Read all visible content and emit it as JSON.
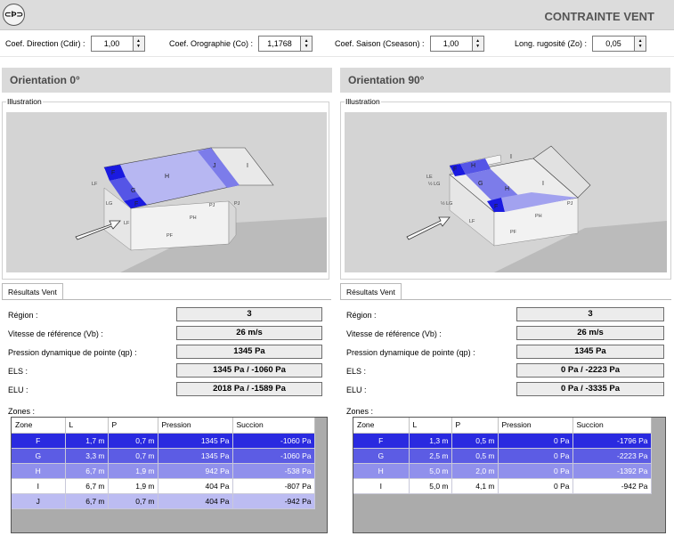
{
  "header": {
    "logo_text": "⊂Þ⊃",
    "title": "CONTRAINTE VENT"
  },
  "coefs": [
    {
      "label": "Coef. Direction (Cdir) :",
      "value": "1,00"
    },
    {
      "label": "Coef. Orographie (Co) :",
      "value": "1,1768"
    },
    {
      "label": "Coef. Saison (Cseason) :",
      "value": "1,00"
    },
    {
      "label": "Long. rugosité (Zo) :",
      "value": "0,05"
    }
  ],
  "panels": [
    {
      "title": "Orientation 0°",
      "illustration_label": "Illustration",
      "tab": "Résultats Vent",
      "region_label": "Région :",
      "region": "3",
      "vb_label": "Vitesse de référence (Vb) :",
      "vb": "26 m/s",
      "qp_label": "Pression dynamique de pointe (qp) :",
      "qp": "1345 Pa",
      "els_label": "ELS :",
      "els": "1345 Pa / -1060 Pa",
      "elu_label": "ELU :",
      "elu": "2018 Pa / -1589 Pa",
      "zones_label": "Zones :",
      "columns": [
        "Zone",
        "L",
        "P",
        "Pression",
        "Succion"
      ],
      "rows": [
        {
          "zone": "F",
          "l": "1,7 m",
          "p": "0,7 m",
          "pression": "1345 Pa",
          "succion": "-1060 Pa",
          "color": "#2a2ae0",
          "text": "#ffffff"
        },
        {
          "zone": "G",
          "l": "3,3 m",
          "p": "0,7 m",
          "pression": "1345 Pa",
          "succion": "-1060 Pa",
          "color": "#5c5ce4",
          "text": "#ffffff"
        },
        {
          "zone": "H",
          "l": "6,7 m",
          "p": "1,9 m",
          "pression": "942 Pa",
          "succion": "-538 Pa",
          "color": "#9090ec",
          "text": "#ffffff"
        },
        {
          "zone": "I",
          "l": "6,7 m",
          "p": "1,9 m",
          "pression": "404 Pa",
          "succion": "-807 Pa",
          "color": "#ffffff",
          "text": "#000000"
        },
        {
          "zone": "J",
          "l": "6,7 m",
          "p": "0,7 m",
          "pression": "404 Pa",
          "succion": "-942 Pa",
          "color": "#bcbcf2",
          "text": "#000000"
        }
      ],
      "roof_labels": [
        "F",
        "G",
        "F",
        "H",
        "J",
        "I"
      ],
      "wall_labels": [
        "LF",
        "LG",
        "LF",
        "PH",
        "PF",
        "PJ",
        "PJ"
      ]
    },
    {
      "title": "Orientation 90°",
      "illustration_label": "Illustration",
      "tab": "Résultats Vent",
      "region_label": "Région :",
      "region": "3",
      "vb_label": "Vitesse de référence (Vb) :",
      "vb": "26 m/s",
      "qp_label": "Pression dynamique de pointe (qp) :",
      "qp": "1345 Pa",
      "els_label": "ELS :",
      "els": "0 Pa / -2223 Pa",
      "elu_label": "ELU :",
      "elu": "0 Pa / -3335 Pa",
      "zones_label": "Zones :",
      "columns": [
        "Zone",
        "L",
        "P",
        "Pression",
        "Succion"
      ],
      "rows": [
        {
          "zone": "F",
          "l": "1,3 m",
          "p": "0,5 m",
          "pression": "0 Pa",
          "succion": "-1796 Pa",
          "color": "#2a2ae0",
          "text": "#ffffff"
        },
        {
          "zone": "G",
          "l": "2,5 m",
          "p": "0,5 m",
          "pression": "0 Pa",
          "succion": "-2223 Pa",
          "color": "#5c5ce4",
          "text": "#ffffff"
        },
        {
          "zone": "H",
          "l": "5,0 m",
          "p": "2,0 m",
          "pression": "0 Pa",
          "succion": "-1392 Pa",
          "color": "#9090ec",
          "text": "#ffffff"
        },
        {
          "zone": "I",
          "l": "5,0 m",
          "p": "4,1 m",
          "pression": "0 Pa",
          "succion": "-942 Pa",
          "color": "#ffffff",
          "text": "#000000"
        }
      ],
      "roof_labels": [
        "F",
        "G",
        "F",
        "H",
        "H",
        "I",
        "I"
      ],
      "wall_labels": [
        "LE",
        "½ LG",
        "½ LG",
        "LF",
        "PH",
        "PF",
        "PJ"
      ]
    }
  ]
}
